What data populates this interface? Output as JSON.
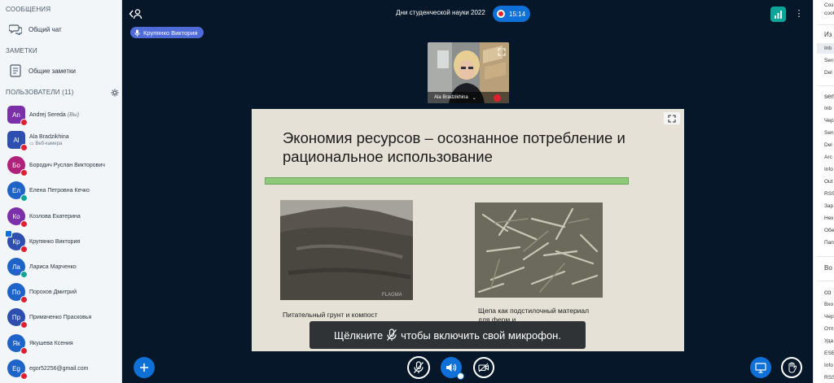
{
  "sidebar": {
    "messages_title": "СООБЩЕНИЯ",
    "public_chat": "Общий чат",
    "notes_title": "ЗАМЕТКИ",
    "shared_notes": "Общие заметки",
    "users_title": "ПОЛЬЗОВАТЕЛИ (11)",
    "users": [
      {
        "initials": "An",
        "name": "Andrej Sereda",
        "suffix": "(Вы)",
        "sub": "",
        "color": "#7b2fa8",
        "shape": "square",
        "mic": "muted",
        "presenter": false
      },
      {
        "initials": "Al",
        "name": "Ala Bradzikhina",
        "suffix": "",
        "sub": "Веб-камера",
        "color": "#2e4fb0",
        "shape": "square",
        "mic": "muted",
        "presenter": false
      },
      {
        "initials": "Бо",
        "name": "Бородич Руслан Викторович",
        "suffix": "",
        "sub": "",
        "color": "#b0227a",
        "shape": "round",
        "mic": "muted",
        "presenter": false
      },
      {
        "initials": "Ел",
        "name": "Елена Петровна Кечко",
        "suffix": "",
        "sub": "",
        "color": "#1e63c8",
        "shape": "round",
        "mic": "listen",
        "presenter": false
      },
      {
        "initials": "Ко",
        "name": "Козлова Екатерина",
        "suffix": "",
        "sub": "",
        "color": "#7b2fa8",
        "shape": "round",
        "mic": "muted",
        "presenter": false
      },
      {
        "initials": "Кр",
        "name": "Крупянко Виктория",
        "suffix": "",
        "sub": "",
        "color": "#2e4fb0",
        "shape": "round",
        "mic": "muted",
        "presenter": true
      },
      {
        "initials": "Ла",
        "name": "Лариса Марченко",
        "suffix": "",
        "sub": "",
        "color": "#1e63c8",
        "shape": "round",
        "mic": "listen",
        "presenter": false
      },
      {
        "initials": "По",
        "name": "Порохов Дмитрий",
        "suffix": "",
        "sub": "",
        "color": "#1e63c8",
        "shape": "round",
        "mic": "muted",
        "presenter": false
      },
      {
        "initials": "Пр",
        "name": "Примаченко Прасковья",
        "suffix": "",
        "sub": "",
        "color": "#2e4fb0",
        "shape": "round",
        "mic": "muted",
        "presenter": false
      },
      {
        "initials": "Як",
        "name": "Якушева Ксения",
        "suffix": "",
        "sub": "",
        "color": "#1e63c8",
        "shape": "round",
        "mic": "muted",
        "presenter": false
      },
      {
        "initials": "Eg",
        "name": "egor52256@gmail.com",
        "suffix": "",
        "sub": "",
        "color": "#1e63c8",
        "shape": "round",
        "mic": "muted",
        "presenter": false
      }
    ]
  },
  "topbar": {
    "meeting_title": "Дни студенческой науки 2022",
    "timer": "15:14",
    "speaker": "Крупянко Виктория"
  },
  "video": {
    "name": "Ala Bradzikhina"
  },
  "slide": {
    "title": "Экономия ресурсов – осознанное потребление и рациональное использование",
    "caption1": "Питательный грунт и компост",
    "caption2": "Щепа как подстилочный материал для ферм и",
    "watermark": "FLAGMA"
  },
  "notice": {
    "before": "Щёлкните",
    "after": "чтобы включить свой микрофон."
  },
  "colors": {
    "app_bg": "#06172a",
    "accent": "#0f70d7",
    "muted": "#e0202e",
    "listen": "#0ba59a",
    "connection": "#0ba59a"
  },
  "right_panel": {
    "items": [
      "Соз",
      "сооб",
      "Из",
      "Inb",
      "Sen",
      "Del",
      "sen",
      "Inb",
      "Чер",
      "Sen",
      "Del",
      "Arc",
      "Info",
      "Out",
      "RSS",
      "Зар",
      "Нех",
      "Обе",
      "Пап",
      "Во",
      "co",
      "Вхо",
      "Чер",
      "Отп",
      "Уда",
      "ESE",
      "Info",
      "RSS"
    ]
  }
}
